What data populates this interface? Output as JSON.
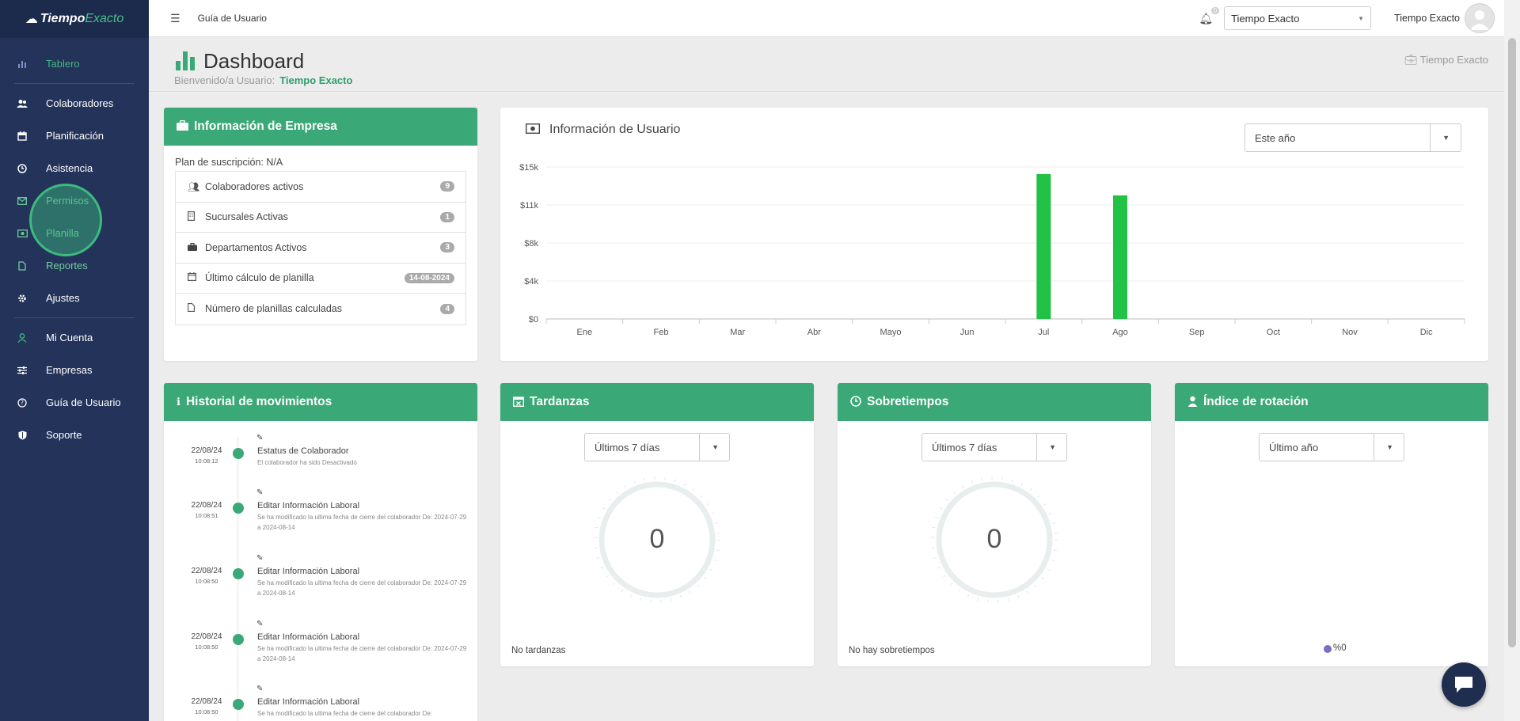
{
  "brand": {
    "part1": "Tiempo",
    "part2": "Exacto"
  },
  "sidebar": {
    "items": [
      {
        "label": "Tablero",
        "icon": "bar-chart-icon"
      },
      {
        "label": "Colaboradores",
        "icon": "users-icon"
      },
      {
        "label": "Planificación",
        "icon": "calendar-icon"
      },
      {
        "label": "Asistencia",
        "icon": "clock-icon"
      },
      {
        "label": "Permisos",
        "icon": "envelope-icon"
      },
      {
        "label": "Planilla",
        "icon": "money-icon"
      },
      {
        "label": "Reportes",
        "icon": "file-icon"
      },
      {
        "label": "Ajustes",
        "icon": "gear-icon"
      },
      {
        "label": "Mi Cuenta",
        "icon": "user-icon"
      },
      {
        "label": "Empresas",
        "icon": "sliders-icon"
      },
      {
        "label": "Guía de Usuario",
        "icon": "question-icon"
      },
      {
        "label": "Soporte",
        "icon": "shield-icon"
      }
    ]
  },
  "topbar": {
    "guide_link": "Guía de Usuario",
    "notifications_count": "0",
    "company_selected": "Tiempo Exacto",
    "user_name": "Tiempo Exacto"
  },
  "header": {
    "title": "Dashboard",
    "welcome": "Bienvenido/a Usuario:",
    "user": "Tiempo Exacto",
    "company": "Tiempo Exacto"
  },
  "empresa": {
    "title": "Información de Empresa",
    "plan": "Plan de suscripción: N/A",
    "rows": [
      {
        "label": "Colaboradores activos",
        "badge": "9"
      },
      {
        "label": "Sucursales Activas",
        "badge": "1"
      },
      {
        "label": "Departamentos Activos",
        "badge": "3"
      },
      {
        "label": "Último cálculo de planilla",
        "badge": "14-08-2024"
      },
      {
        "label": "Número de planillas calculadas",
        "badge": "4"
      }
    ]
  },
  "usuario": {
    "title": "Información de Usuario",
    "period": "Este año"
  },
  "chart_data": {
    "type": "bar",
    "categories": [
      "Ene",
      "Feb",
      "Mar",
      "Abr",
      "Mayo",
      "Jun",
      "Jul",
      "Ago",
      "Sep",
      "Oct",
      "Nov",
      "Dic"
    ],
    "values": [
      0,
      0,
      0,
      0,
      0,
      0,
      14300,
      12200,
      0,
      0,
      0,
      0
    ],
    "yticks": [
      "$0",
      "$4k",
      "$8k",
      "$11k",
      "$15k"
    ],
    "ylim": [
      0,
      15000
    ],
    "bar_color": "#22c246",
    "grid": true
  },
  "historial": {
    "title": "Historial de movimientos",
    "items": [
      {
        "date": "22/08/24",
        "time": "10:08:12",
        "title": "Estatus de Colaborador",
        "desc": "El colaborador ha sido Desactivado"
      },
      {
        "date": "22/08/24",
        "time": "10:08:51",
        "title": "Editar Información Laboral",
        "desc": "Se ha modificado la ultima fecha de cierre del colaborador De: 2024-07-29 a 2024-08-14"
      },
      {
        "date": "22/08/24",
        "time": "10:08:50",
        "title": "Editar Información Laboral",
        "desc": "Se ha modificado la ultima fecha de cierre del colaborador De: 2024-07-29 a 2024-08-14"
      },
      {
        "date": "22/08/24",
        "time": "10:08:50",
        "title": "Editar Información Laboral",
        "desc": "Se ha modificado la ultima fecha de cierre del colaborador De: 2024-07-29 a 2024-08-14"
      },
      {
        "date": "22/08/24",
        "time": "10:08:50",
        "title": "Editar Información Laboral",
        "desc": "Se ha modificado la ultima fecha de cierre del colaborador De:"
      }
    ]
  },
  "tardanzas": {
    "title": "Tardanzas",
    "period": "Últimos 7 días",
    "value": "0",
    "footer": "No tardanzas"
  },
  "sobretiempos": {
    "title": "Sobretiempos",
    "period": "Últimos 7 días",
    "value": "0",
    "footer": "No hay sobretiempos"
  },
  "rotacion": {
    "title": "Índice de rotación",
    "period": "Último año",
    "legend": "%0"
  },
  "colors": {
    "accent": "#3aa877",
    "sidebar": "#24335a",
    "bar": "#22c246"
  }
}
